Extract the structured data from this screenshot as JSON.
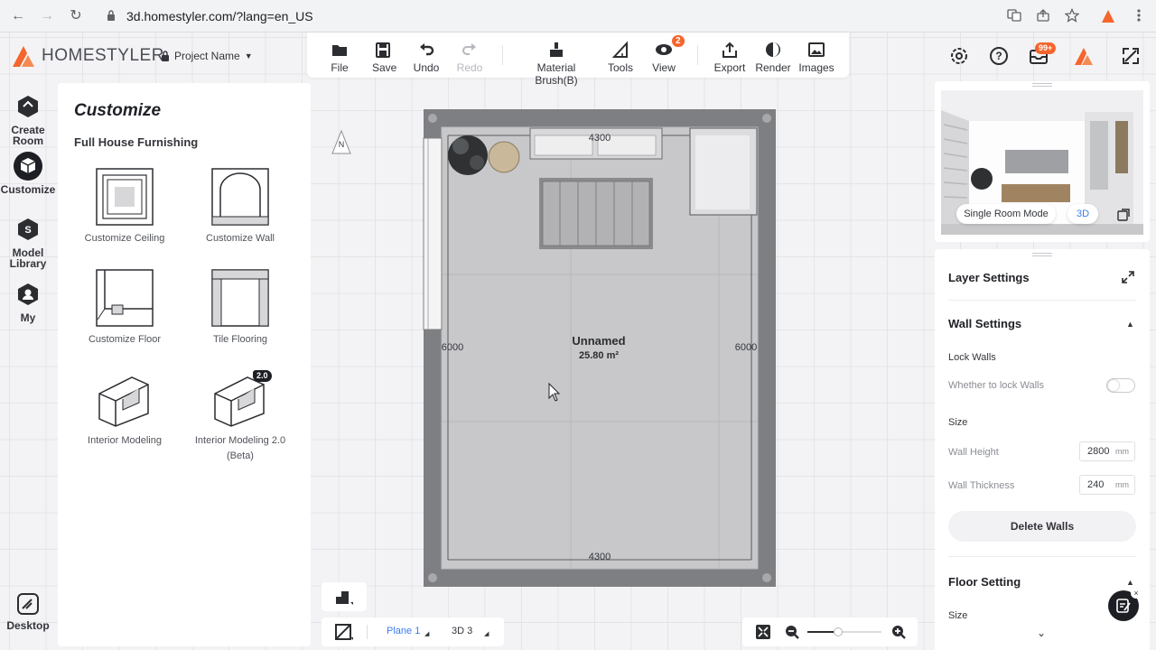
{
  "browser": {
    "url": "3d.homestyler.com/?lang=en_US"
  },
  "brand": {
    "name": "HOMESTYLER",
    "project": "Project Name"
  },
  "toolbar": {
    "file": "File",
    "save": "Save",
    "undo": "Undo",
    "redo": "Redo",
    "material_brush": "Material Brush(B)",
    "tools": "Tools",
    "view": "View",
    "view_badge": "2",
    "export": "Export",
    "render": "Render",
    "images": "Images"
  },
  "topright": {
    "inbox_badge": "99+"
  },
  "rail": {
    "create_room": "Create Room",
    "customize": "Customize",
    "model_library": "Model Library",
    "my": "My",
    "desktop": "Desktop"
  },
  "panel": {
    "title": "Customize",
    "section": "Full House Furnishing",
    "tiles": [
      {
        "label": "Customize Ceiling"
      },
      {
        "label": "Customize Wall"
      },
      {
        "label": "Customize Floor"
      },
      {
        "label": "Tile Flooring"
      },
      {
        "label": "Interior Modeling"
      },
      {
        "label": "Interior Modeling 2.0 (Beta)",
        "badge": "2.0"
      }
    ]
  },
  "plan": {
    "room_name": "Unnamed",
    "area": "25.80 m²",
    "dim_top": "4300",
    "dim_bottom": "4300",
    "dim_left": "6000",
    "dim_right": "6000",
    "compass": "N"
  },
  "preview": {
    "mode": "Single Room Mode",
    "view": "3D"
  },
  "settings": {
    "layer_title": "Layer Settings",
    "wall_title": "Wall Settings",
    "lock_walls": "Lock Walls",
    "lock_desc": "Whether to lock Walls",
    "lock_on": false,
    "size": "Size",
    "wall_height_label": "Wall Height",
    "wall_height": "2800",
    "wall_thickness_label": "Wall Thickness",
    "wall_thickness": "240",
    "unit": "mm",
    "delete_walls": "Delete Walls",
    "floor_title": "Floor Setting",
    "floor_size": "Size"
  },
  "bottom": {
    "plane": "Plane 1",
    "view3d": "3D 3"
  },
  "colors": {
    "accent": "#f5652c",
    "link": "#3b7cf5",
    "dark": "#1d1f24"
  }
}
